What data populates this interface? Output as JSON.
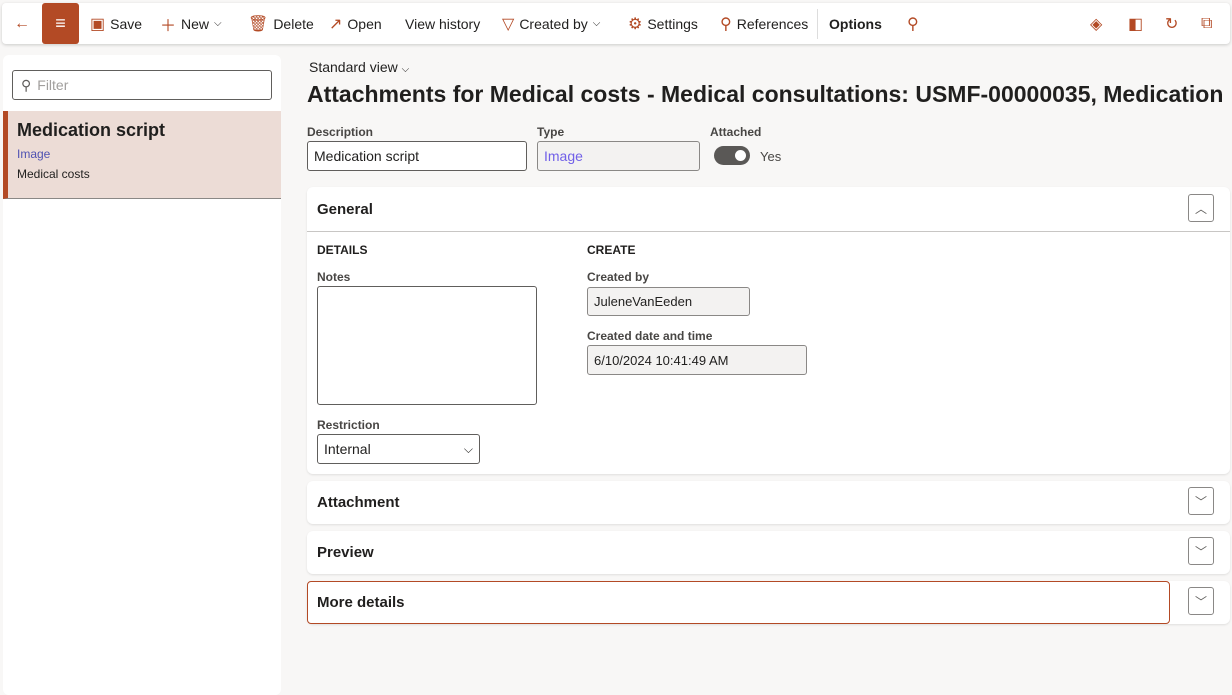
{
  "toolbar": {
    "save": "Save",
    "new": "New",
    "delete": "Delete",
    "open": "Open",
    "view_history": "View history",
    "created_by": "Created by",
    "settings": "Settings",
    "references": "References",
    "options": "Options"
  },
  "list": {
    "filter_placeholder": "Filter",
    "item": {
      "title": "Medication script",
      "type": "Image",
      "area": "Medical costs"
    }
  },
  "header": {
    "view": "Standard view",
    "title": "Attachments for Medical costs - Medical consultations: USMF-00000035, Medication"
  },
  "fields": {
    "description_label": "Description",
    "description": "Medication script",
    "type_label": "Type",
    "type": "Image",
    "attached_label": "Attached",
    "attached": "Yes",
    "attached_on": true
  },
  "general": {
    "title": "General",
    "details": "DETAILS",
    "notes_label": "Notes",
    "notes": "",
    "restriction_label": "Restriction",
    "restriction": "Internal",
    "create": "CREATE",
    "created_by_label": "Created by",
    "created_by": "JuleneVanEeden",
    "created_dt_label": "Created date and time",
    "created_dt": "6/10/2024 10:41:49 AM"
  },
  "sections": {
    "attachment": "Attachment",
    "preview": "Preview",
    "more_details": "More details"
  },
  "colors": {
    "accent": "#b34a25",
    "selected_bg": "#ecdcd6",
    "link": "#4f52b2"
  }
}
